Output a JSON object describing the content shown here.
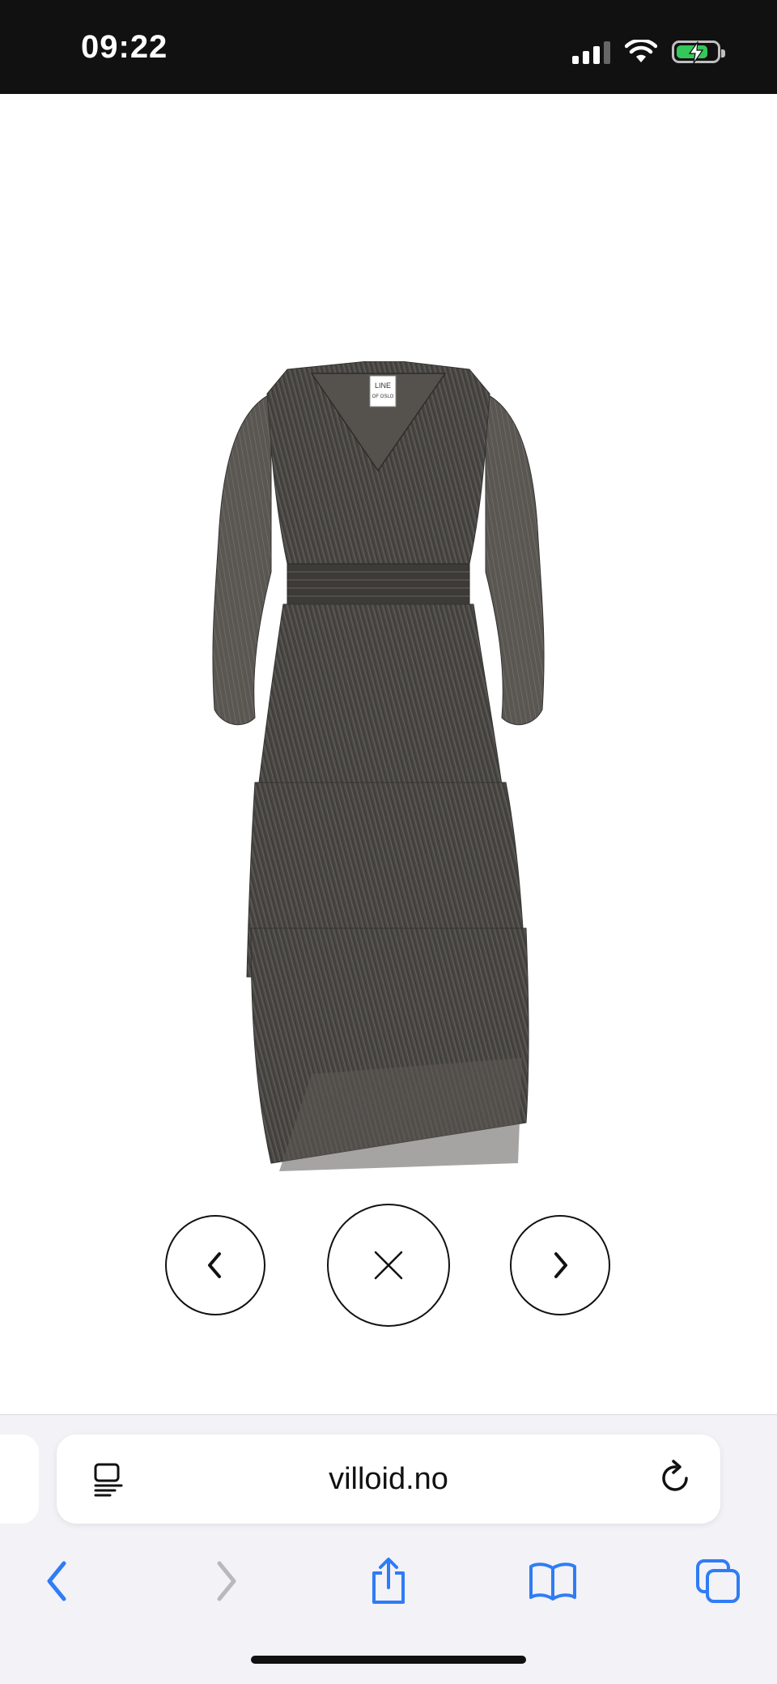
{
  "status_bar": {
    "time": "09:22",
    "icons": [
      "signal-icon",
      "wifi-icon",
      "battery-charging-icon"
    ],
    "battery_level": 0.8,
    "battery_color": "#34c759"
  },
  "product": {
    "image_alt": "dress-image",
    "label_text": "LINE OF OSLO",
    "dress_color": "#4a4844"
  },
  "gallery_controls": {
    "prev_icon": "chevron-left-icon",
    "close_icon": "close-icon",
    "next_icon": "chevron-right-icon"
  },
  "browser": {
    "url": "villoid.no",
    "reader_icon": "reader-icon",
    "reload_icon": "reload-icon",
    "accent_color": "#2f7cf6",
    "disabled_color": "#b8b8bd",
    "toolbar": [
      "back-icon",
      "forward-icon",
      "share-icon",
      "bookmarks-icon",
      "tabs-icon"
    ]
  }
}
